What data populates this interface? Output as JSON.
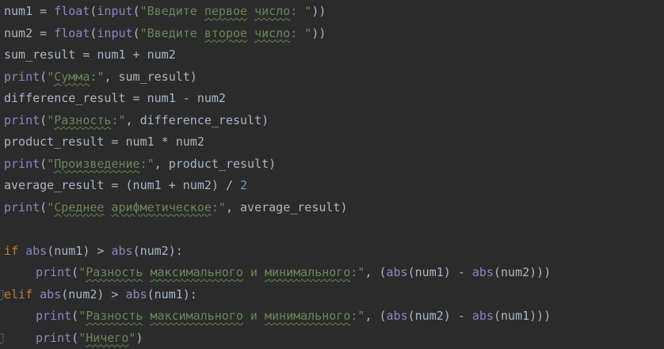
{
  "editor": {
    "lines": [
      {
        "indent": false,
        "tokens": [
          {
            "t": "plain",
            "v": "num1 = "
          },
          {
            "t": "builtin",
            "v": "float"
          },
          {
            "t": "plain",
            "v": "("
          },
          {
            "t": "builtin",
            "v": "input"
          },
          {
            "t": "plain",
            "v": "("
          },
          {
            "t": "str",
            "v": "\"Введите "
          },
          {
            "t": "str",
            "v": "первое",
            "typo": true
          },
          {
            "t": "str",
            "v": " "
          },
          {
            "t": "str",
            "v": "число",
            "typo": true
          },
          {
            "t": "str",
            "v": ": \""
          },
          {
            "t": "plain",
            "v": "))"
          }
        ]
      },
      {
        "indent": false,
        "tokens": [
          {
            "t": "plain",
            "v": "num2 = "
          },
          {
            "t": "builtin",
            "v": "float"
          },
          {
            "t": "plain",
            "v": "("
          },
          {
            "t": "builtin",
            "v": "input"
          },
          {
            "t": "plain",
            "v": "("
          },
          {
            "t": "str",
            "v": "\"Введите "
          },
          {
            "t": "str",
            "v": "второе",
            "typo": true
          },
          {
            "t": "str",
            "v": " "
          },
          {
            "t": "str",
            "v": "число",
            "typo": true
          },
          {
            "t": "str",
            "v": ": \""
          },
          {
            "t": "plain",
            "v": "))"
          }
        ]
      },
      {
        "indent": false,
        "tokens": [
          {
            "t": "plain",
            "v": "sum_result = num1 + num2"
          }
        ]
      },
      {
        "indent": false,
        "tokens": [
          {
            "t": "builtin",
            "v": "print"
          },
          {
            "t": "plain",
            "v": "("
          },
          {
            "t": "str",
            "v": "\""
          },
          {
            "t": "str",
            "v": "Сумма",
            "typo": true
          },
          {
            "t": "str",
            "v": ":\""
          },
          {
            "t": "plain",
            "v": ", sum_result)"
          }
        ]
      },
      {
        "indent": false,
        "tokens": [
          {
            "t": "plain",
            "v": "difference_result = num1 - num2"
          }
        ]
      },
      {
        "indent": false,
        "tokens": [
          {
            "t": "builtin",
            "v": "print"
          },
          {
            "t": "plain",
            "v": "("
          },
          {
            "t": "str",
            "v": "\""
          },
          {
            "t": "str",
            "v": "Разность",
            "typo": true
          },
          {
            "t": "str",
            "v": ":\""
          },
          {
            "t": "plain",
            "v": ", difference_result)"
          }
        ]
      },
      {
        "indent": false,
        "tokens": [
          {
            "t": "plain",
            "v": "product_result = num1 * num2"
          }
        ]
      },
      {
        "indent": false,
        "tokens": [
          {
            "t": "builtin",
            "v": "print"
          },
          {
            "t": "plain",
            "v": "("
          },
          {
            "t": "str",
            "v": "\""
          },
          {
            "t": "str",
            "v": "Произведение",
            "typo": true
          },
          {
            "t": "str",
            "v": ":\""
          },
          {
            "t": "plain",
            "v": ", product_result)"
          }
        ]
      },
      {
        "indent": false,
        "tokens": [
          {
            "t": "plain",
            "v": "average_result = (num1 + num2) / "
          },
          {
            "t": "num",
            "v": "2"
          }
        ]
      },
      {
        "indent": false,
        "tokens": [
          {
            "t": "builtin",
            "v": "print"
          },
          {
            "t": "plain",
            "v": "("
          },
          {
            "t": "str",
            "v": "\""
          },
          {
            "t": "str",
            "v": "Среднее",
            "typo": true
          },
          {
            "t": "str",
            "v": " "
          },
          {
            "t": "str",
            "v": "арифметическое",
            "typo": true
          },
          {
            "t": "str",
            "v": ":\""
          },
          {
            "t": "plain",
            "v": ", average_result)"
          }
        ]
      },
      {
        "indent": false,
        "tokens": []
      },
      {
        "indent": false,
        "tokens": [
          {
            "t": "kw",
            "v": "if "
          },
          {
            "t": "builtin",
            "v": "abs"
          },
          {
            "t": "plain",
            "v": "(num1) > "
          },
          {
            "t": "builtin",
            "v": "abs"
          },
          {
            "t": "plain",
            "v": "(num2):"
          }
        ]
      },
      {
        "indent": true,
        "tokens": [
          {
            "t": "builtin",
            "v": "print"
          },
          {
            "t": "plain",
            "v": "("
          },
          {
            "t": "str",
            "v": "\""
          },
          {
            "t": "str",
            "v": "Разность",
            "typo": true
          },
          {
            "t": "str",
            "v": " "
          },
          {
            "t": "str",
            "v": "максимального",
            "typo": true
          },
          {
            "t": "str",
            "v": " и "
          },
          {
            "t": "str",
            "v": "минимального",
            "typo": true
          },
          {
            "t": "str",
            "v": ":\""
          },
          {
            "t": "plain",
            "v": ", ("
          },
          {
            "t": "builtin",
            "v": "abs"
          },
          {
            "t": "plain",
            "v": "(num1) - "
          },
          {
            "t": "builtin",
            "v": "abs"
          },
          {
            "t": "plain",
            "v": "(num2)))"
          }
        ]
      },
      {
        "indent": false,
        "gutter": true,
        "tokens": [
          {
            "t": "kw",
            "v": "elif "
          },
          {
            "t": "builtin",
            "v": "abs"
          },
          {
            "t": "plain",
            "v": "(num2) > "
          },
          {
            "t": "builtin",
            "v": "abs"
          },
          {
            "t": "plain",
            "v": "(num1):"
          }
        ]
      },
      {
        "indent": true,
        "tokens": [
          {
            "t": "builtin",
            "v": "print"
          },
          {
            "t": "plain",
            "v": "("
          },
          {
            "t": "str",
            "v": "\""
          },
          {
            "t": "str",
            "v": "Разность",
            "typo": true
          },
          {
            "t": "str",
            "v": " "
          },
          {
            "t": "str",
            "v": "максимального",
            "typo": true
          },
          {
            "t": "str",
            "v": " и "
          },
          {
            "t": "str",
            "v": "минимального",
            "typo": true
          },
          {
            "t": "str",
            "v": ":\""
          },
          {
            "t": "plain",
            "v": ", ("
          },
          {
            "t": "builtin",
            "v": "abs"
          },
          {
            "t": "plain",
            "v": "(num2) - "
          },
          {
            "t": "builtin",
            "v": "abs"
          },
          {
            "t": "plain",
            "v": "(num1)))"
          }
        ]
      },
      {
        "indent": true,
        "gutter": true,
        "tokens": [
          {
            "t": "builtin",
            "v": "print"
          },
          {
            "t": "plain",
            "v": "("
          },
          {
            "t": "str",
            "v": "\""
          },
          {
            "t": "str",
            "v": "Ничего",
            "typo": true
          },
          {
            "t": "str",
            "v": "\""
          },
          {
            "t": "plain",
            "v": ")"
          }
        ]
      }
    ]
  },
  "colors": {
    "background": "#2b2b2b",
    "plain": "#a9b7c6",
    "keyword": "#cc7832",
    "builtin": "#8888c6",
    "string": "#6a8759",
    "number": "#6897bb",
    "typo_underline": "#5f8c45"
  },
  "icons": {
    "gutter_fold": "fold-marker-icon"
  }
}
